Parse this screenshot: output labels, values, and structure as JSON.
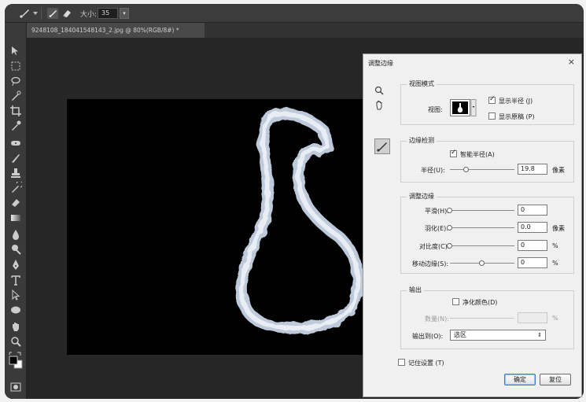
{
  "options_bar": {
    "size_label": "大小:",
    "size_value": "35"
  },
  "document": {
    "tab_title": "9248108_184041548143_2.jpg @ 80%(RGB/8#) *"
  },
  "dialog": {
    "title": "调整边缘",
    "close": "×",
    "view_mode": {
      "legend": "视图模式",
      "view_label": "视图:",
      "show_radius": {
        "label": "显示半径 (J)",
        "checked": true
      },
      "show_original": {
        "label": "显示原稿 (P)",
        "checked": false
      }
    },
    "edge_detection": {
      "legend": "边缘检测",
      "smart_radius": {
        "label": "智能半径(A)",
        "checked": true
      },
      "radius": {
        "label": "半径(U):",
        "value": "19.8",
        "unit": "像素",
        "level": 0.26
      }
    },
    "adjust_edge": {
      "legend": "调整边缘",
      "smooth": {
        "label": "平滑(H):",
        "value": "0",
        "unit": "",
        "level": 0
      },
      "feather": {
        "label": "羽化(E):",
        "value": "0.0",
        "unit": "像素",
        "level": 0
      },
      "contrast": {
        "label": "对比度(C):",
        "value": "0",
        "unit": "%",
        "level": 0
      },
      "shift_edge": {
        "label": "移动边缘(S):",
        "value": "0",
        "unit": "%",
        "level": 0.5
      }
    },
    "output": {
      "legend": "输出",
      "decontaminate": {
        "label": "净化颜色(D)",
        "checked": false
      },
      "amount": {
        "label": "数量(N):",
        "value": "",
        "unit": "%"
      },
      "output_to": {
        "label": "输出到(O):",
        "value": "选区"
      }
    },
    "remember": {
      "label": "记住设置 (T)",
      "checked": false
    },
    "ok_label": "确定",
    "reset_label": "复位"
  },
  "colors": {
    "chrome_bg": "#2b2b2b",
    "panel_bg": "#3a3a3a",
    "dialog_bg": "#f0f0f0",
    "selection_stroke": "#c9d4e6"
  },
  "icons": [
    "brush-icon",
    "eraser-icon",
    "move-icon",
    "marquee-icon",
    "lasso-icon",
    "quick-select-icon",
    "crop-icon",
    "eyedropper-icon",
    "healing-icon",
    "brush-tool-icon",
    "stamp-icon",
    "history-brush-icon",
    "eraser-tool-icon",
    "gradient-icon",
    "blur-icon",
    "dodge-icon",
    "pen-icon",
    "type-icon",
    "path-select-icon",
    "ellipse-icon",
    "hand-icon",
    "zoom-icon",
    "color-swatches-icon",
    "quick-mask-icon",
    "dialog-zoom-icon",
    "dialog-hand-icon",
    "refine-radius-icon"
  ]
}
